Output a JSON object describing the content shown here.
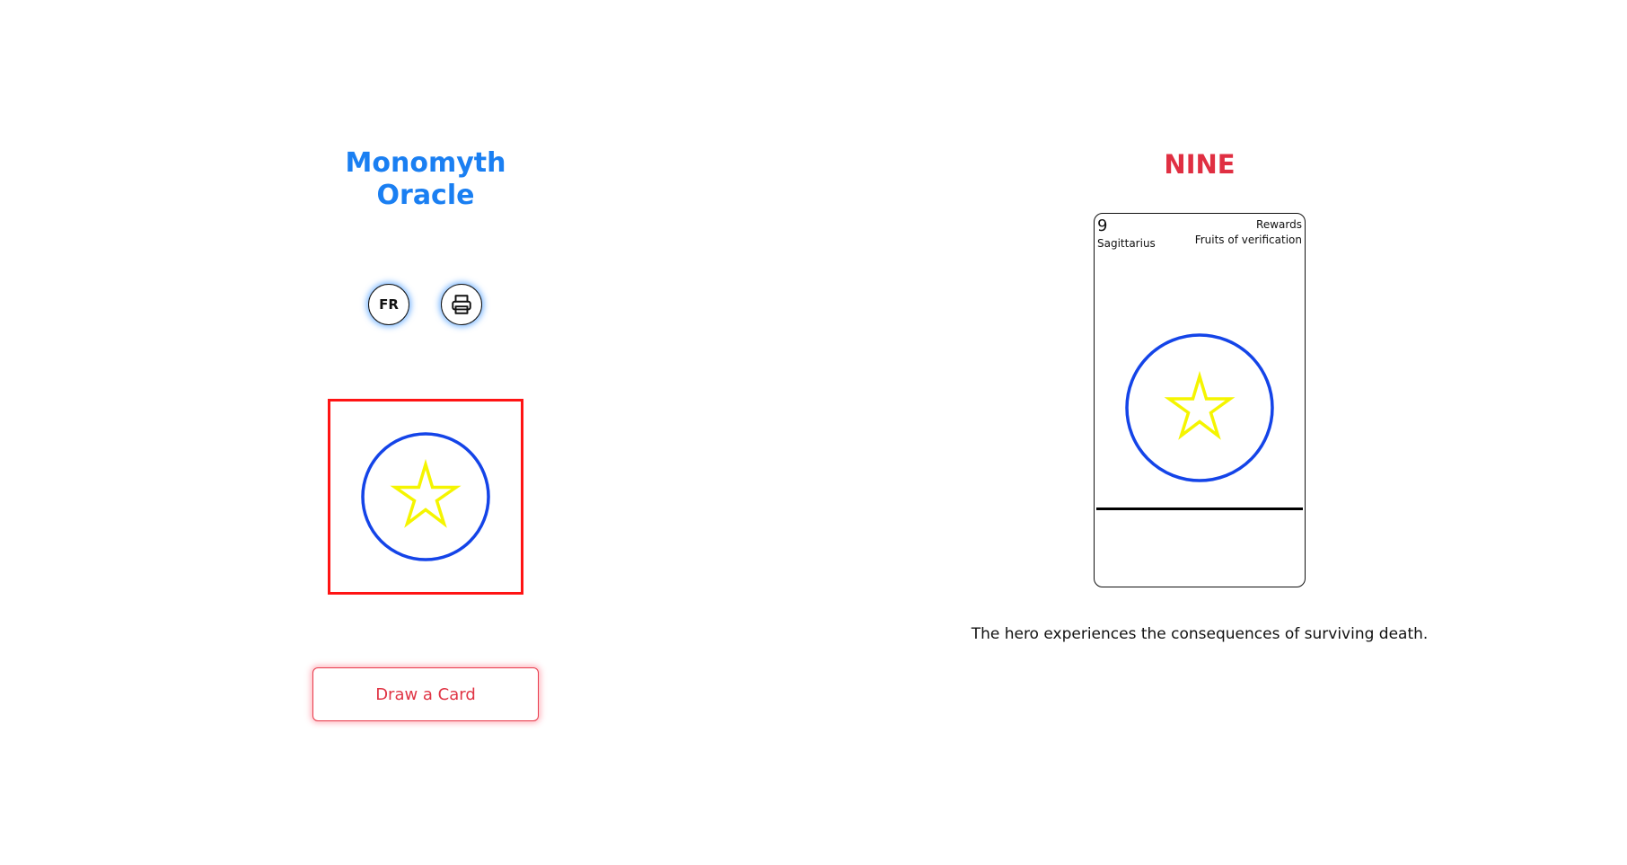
{
  "app": {
    "title": "Monomyth Oracle"
  },
  "controls": {
    "language_label": "FR",
    "print_icon": "printer-icon",
    "draw_label": "Draw a Card"
  },
  "preview": {
    "symbol": "star-in-circle-icon"
  },
  "card": {
    "title": "NINE",
    "number": "9",
    "sign": "Sagittarius",
    "stage": "Rewards",
    "subtitle": "Fruits of verification",
    "symbol": "star-in-circle-icon",
    "description": "The hero experiences the consequences of surviving death."
  },
  "colors": {
    "title_blue": "#1a7ff2",
    "card_title_red": "#e02f42",
    "preview_border": "#ff1414",
    "circle_blue": "#1444e8",
    "star_yellow": "#f5f500",
    "draw_button_red": "#e03545"
  }
}
